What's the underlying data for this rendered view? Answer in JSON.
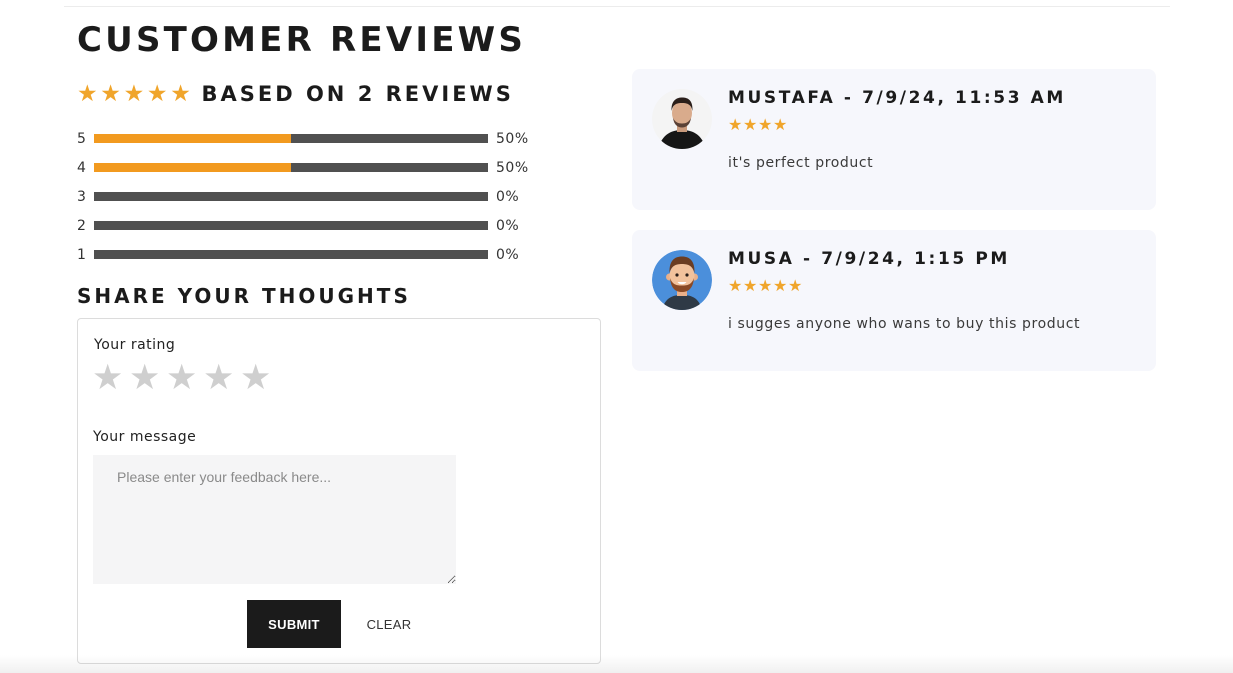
{
  "page": {
    "title": "CUSTOMER REVIEWS"
  },
  "summary": {
    "average_rating": 5,
    "star_icon": "star-filled-icon",
    "star_color": "#f0a52b",
    "text": "BASED ON 2 REVIEWS"
  },
  "breakdown": [
    {
      "stars": "5",
      "percent_label": "50%",
      "fill": 0.5
    },
    {
      "stars": "4",
      "percent_label": "50%",
      "fill": 0.5
    },
    {
      "stars": "3",
      "percent_label": "0%",
      "fill": 0
    },
    {
      "stars": "2",
      "percent_label": "0%",
      "fill": 0
    },
    {
      "stars": "1",
      "percent_label": "0%",
      "fill": 0
    }
  ],
  "bar_colors": {
    "fill": "#f29a1f",
    "track": "#505050"
  },
  "share": {
    "title": "SHARE YOUR THOUGHTS",
    "rating_label": "Your rating",
    "rating_stars": 5,
    "message_label": "Your message",
    "message_placeholder": "Please enter your feedback here...",
    "message_value": "",
    "submit_label": "SUBMIT",
    "clear_label": "CLEAR"
  },
  "reviews": [
    {
      "header": "MUSTAFA - 7/9/24, 11:53 AM",
      "rating": 4,
      "body": "it's perfect product",
      "avatar_icon": "user-photo-avatar"
    },
    {
      "header": "MUSA - 7/9/24, 1:15 PM",
      "rating": 5,
      "body": "i sugges anyone who wans to buy this product",
      "avatar_icon": "cartoon-avatar"
    }
  ]
}
